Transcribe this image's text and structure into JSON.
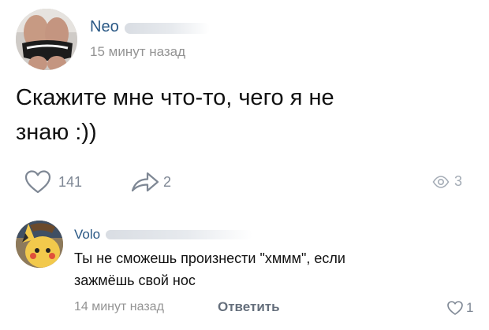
{
  "post": {
    "author_name": "Neo",
    "timestamp": "15 минут назад",
    "text_line1": "Скажите мне что-то, чего я не",
    "text_line2": "знаю :))",
    "likes": "141",
    "shares": "2",
    "views": "3"
  },
  "comment": {
    "author_name": "Volo",
    "text_line1": "Ты не сможешь произнести \"хммм\", если",
    "text_line2": "зажмёшь свой нос",
    "timestamp": "14 минут назад",
    "reply_label": "Ответить",
    "likes": "1"
  },
  "icons": {
    "like": "heart-icon",
    "share": "share-arrow-icon",
    "views": "eye-icon",
    "comment_like": "heart-icon"
  },
  "colors": {
    "author_link": "#2a5885",
    "meta_gray": "#939393",
    "action_gray": "#7e8794"
  }
}
